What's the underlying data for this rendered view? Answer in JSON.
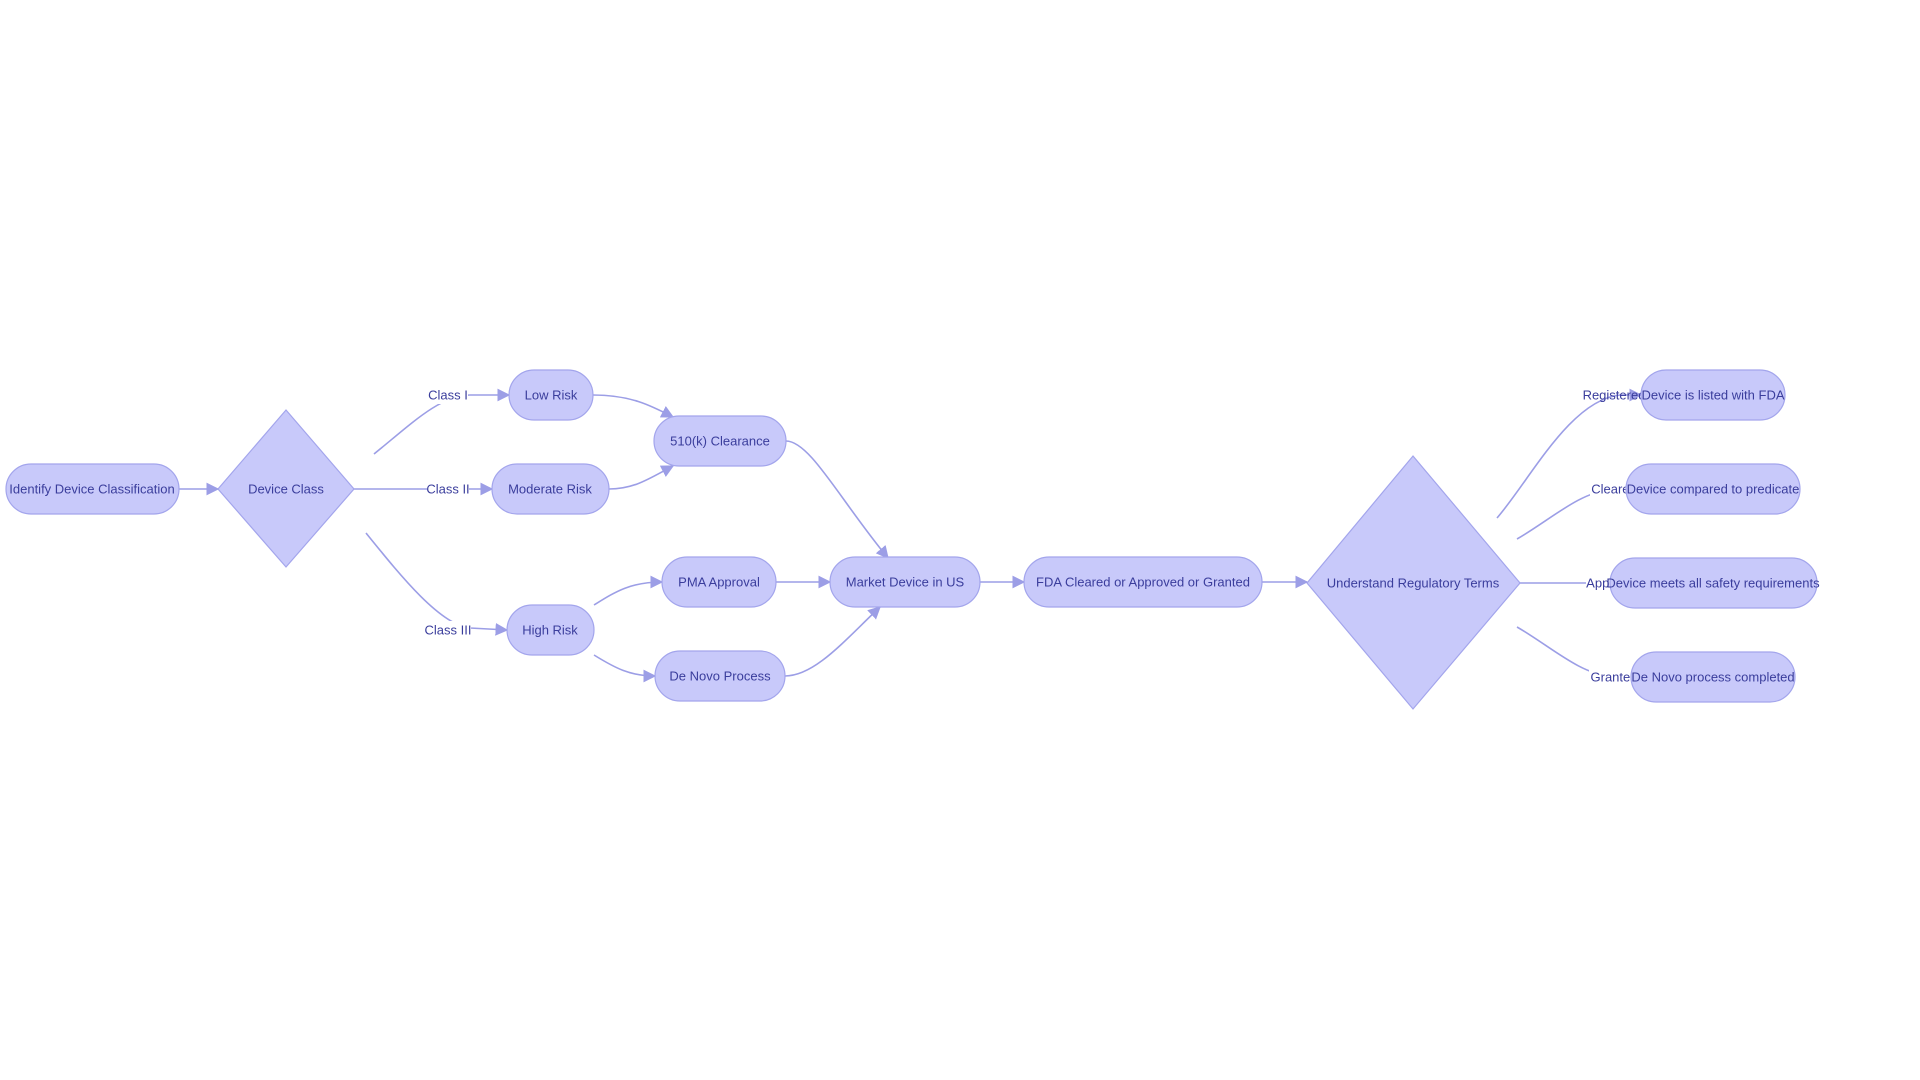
{
  "colors": {
    "node_fill": "#c8c9fa",
    "node_stroke": "#a3a5ec",
    "edge": "#9c9ee6",
    "text": "#3a3d9c"
  },
  "nodes": {
    "identify": "Identify Device Classification",
    "device_class": "Device Class",
    "low_risk": "Low Risk",
    "moderate_risk": "Moderate Risk",
    "high_risk": "High Risk",
    "clearance_510k": "510(k) Clearance",
    "pma": "PMA Approval",
    "de_novo": "De Novo Process",
    "market": "Market Device in US",
    "fda": "FDA Cleared or Approved or Granted",
    "terms": "Understand Regulatory Terms",
    "listed": "Device is listed with FDA",
    "compared": "Device compared to predicate",
    "meets": "Device meets all safety requirements",
    "de_novo_done": "De Novo process completed"
  },
  "edge_labels": {
    "class1": "Class I",
    "class2": "Class II",
    "class3": "Class III",
    "registered": "Registered",
    "cleared": "Cleared",
    "approved": "Approved",
    "granted": "Granted"
  }
}
